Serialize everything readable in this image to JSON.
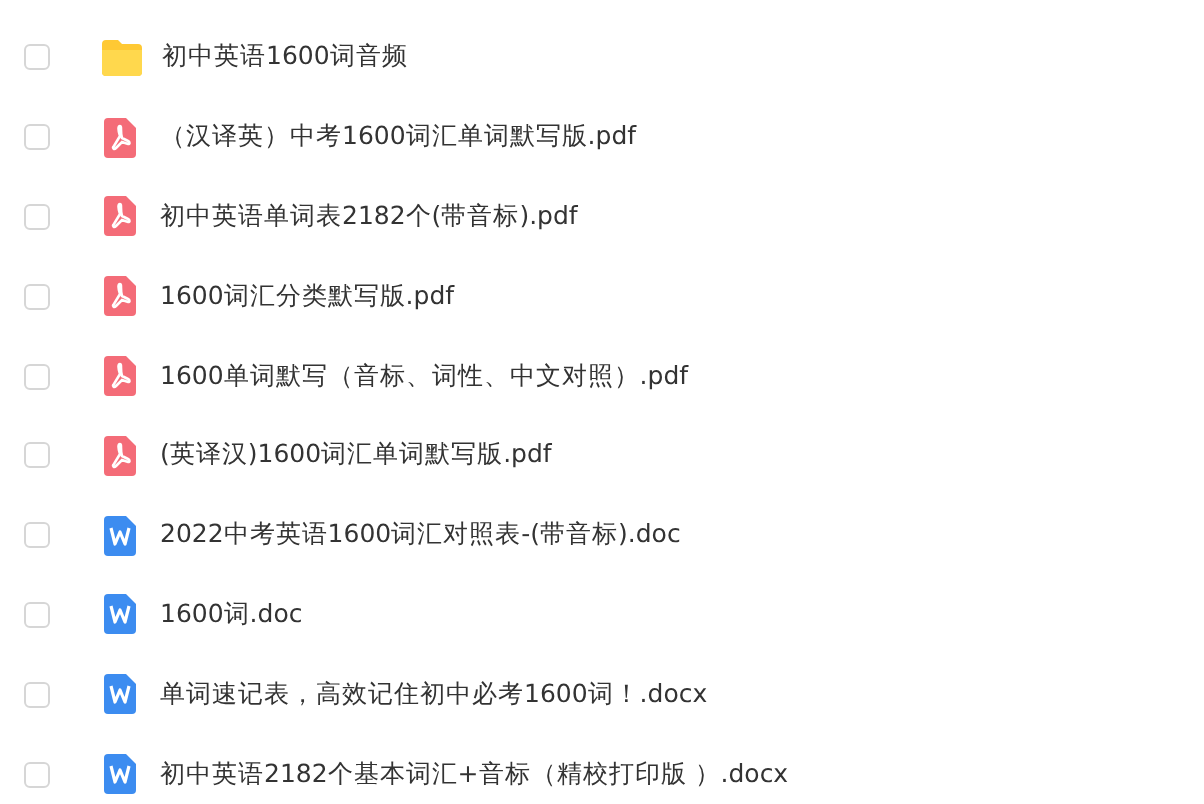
{
  "files": [
    {
      "kind": "folder",
      "name": "初中英语1600词音频",
      "checked": false
    },
    {
      "kind": "pdf",
      "name": "（汉译英）中考1600词汇单词默写版.pdf",
      "checked": false
    },
    {
      "kind": "pdf",
      "name": "初中英语单词表2182个(带音标).pdf",
      "checked": false
    },
    {
      "kind": "pdf",
      "name": "1600词汇分类默写版.pdf",
      "checked": false
    },
    {
      "kind": "pdf",
      "name": "1600单词默写（音标、词性、中文对照）.pdf",
      "checked": false
    },
    {
      "kind": "pdf",
      "name": "(英译汉)1600词汇单词默写版.pdf",
      "checked": false
    },
    {
      "kind": "doc",
      "name": "2022中考英语1600词汇对照表-(带音标).doc",
      "checked": false
    },
    {
      "kind": "doc",
      "name": "1600词.doc",
      "checked": false
    },
    {
      "kind": "doc",
      "name": "单词速记表，高效记住初中必考1600词！.docx",
      "checked": false
    },
    {
      "kind": "doc",
      "name": "初中英语2182个基本词汇+音标（精校打印版 ）.docx",
      "checked": false
    }
  ]
}
